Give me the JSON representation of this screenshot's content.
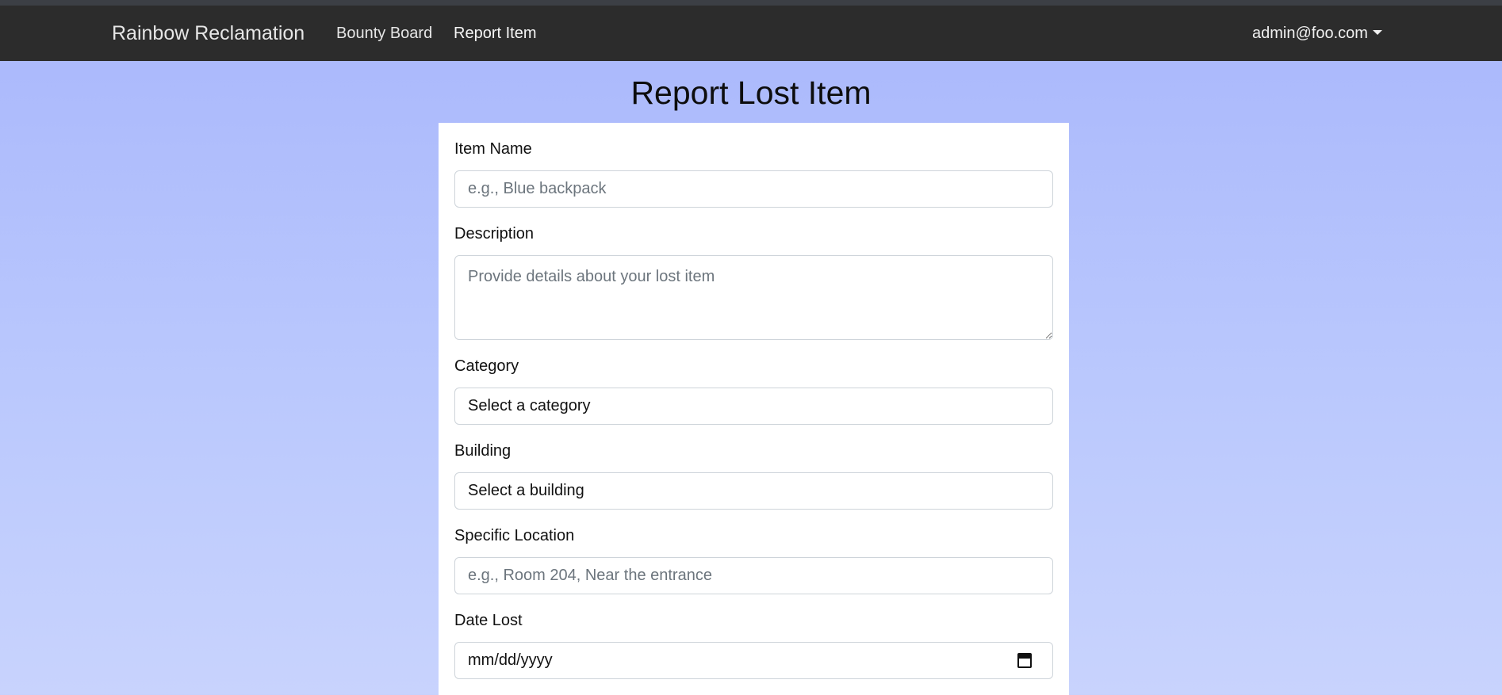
{
  "navbar": {
    "brand": "Rainbow Reclamation",
    "links": [
      "Bounty Board",
      "Report Item"
    ],
    "user": "admin@foo.com"
  },
  "page": {
    "title": "Report Lost Item"
  },
  "form": {
    "item_name_label": "Item Name",
    "item_name_placeholder": "e.g., Blue backpack",
    "description_label": "Description",
    "description_placeholder": "Provide details about your lost item",
    "category_label": "Category",
    "category_value": "Select a category",
    "building_label": "Building",
    "building_value": "Select a building",
    "location_label": "Specific Location",
    "location_placeholder": "e.g., Room 204, Near the entrance",
    "date_label": "Date Lost",
    "date_value": "mm/dd/yyyy",
    "date_icon": "calendar-icon"
  },
  "colors": {
    "navbar_bg": "#2c2c2c",
    "page_bg_top": "#a9b7fc",
    "page_bg_bottom": "#c8d3fd"
  }
}
